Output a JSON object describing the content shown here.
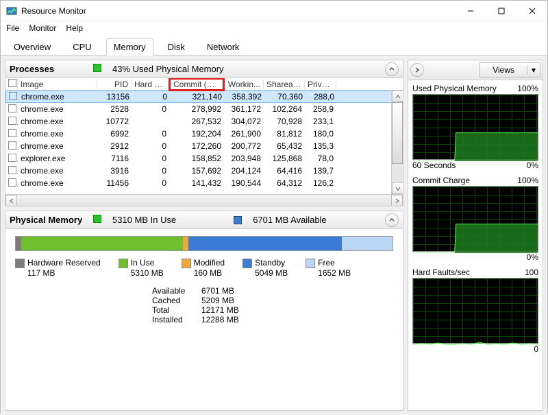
{
  "window": {
    "title": "Resource Monitor"
  },
  "menu": {
    "file": "File",
    "monitor": "Monitor",
    "help": "Help"
  },
  "tabs": {
    "overview": "Overview",
    "cpu": "CPU",
    "memory": "Memory",
    "disk": "Disk",
    "network": "Network"
  },
  "processes": {
    "title": "Processes",
    "summary": "43% Used Physical Memory",
    "columns": {
      "image": "Image",
      "pid": "PID",
      "hard": "Hard Fa...",
      "commit": "Commit (KB)",
      "working": "Workin...",
      "share": "Shareab...",
      "priv": "Privat..."
    },
    "rows": [
      {
        "image": "chrome.exe",
        "pid": "13156",
        "hf": "0",
        "commit": "321,140",
        "work": "358,392",
        "share": "70,360",
        "priv": "288,0"
      },
      {
        "image": "chrome.exe",
        "pid": "2528",
        "hf": "0",
        "commit": "278,992",
        "work": "361,172",
        "share": "102,264",
        "priv": "258,9"
      },
      {
        "image": "chrome.exe",
        "pid": "10772",
        "hf": "",
        "commit": "267,532",
        "work": "304,072",
        "share": "70,928",
        "priv": "233,1"
      },
      {
        "image": "chrome.exe",
        "pid": "6992",
        "hf": "0",
        "commit": "192,204",
        "work": "261,900",
        "share": "81,812",
        "priv": "180,0"
      },
      {
        "image": "chrome.exe",
        "pid": "2912",
        "hf": "0",
        "commit": "172,260",
        "work": "200,772",
        "share": "65,432",
        "priv": "135,3"
      },
      {
        "image": "explorer.exe",
        "pid": "7116",
        "hf": "0",
        "commit": "158,852",
        "work": "203,948",
        "share": "125,868",
        "priv": "78,0"
      },
      {
        "image": "chrome.exe",
        "pid": "3916",
        "hf": "0",
        "commit": "157,692",
        "work": "204,124",
        "share": "64,416",
        "priv": "139,7"
      },
      {
        "image": "chrome.exe",
        "pid": "11456",
        "hf": "0",
        "commit": "141,432",
        "work": "190,544",
        "share": "64,312",
        "priv": "126,2"
      }
    ]
  },
  "physical": {
    "title": "Physical Memory",
    "inuse": "5310 MB In Use",
    "avail": "6701 MB Available",
    "legend": {
      "reserved": {
        "name": "Hardware Reserved",
        "val": "117 MB"
      },
      "inuse": {
        "name": "In Use",
        "val": "5310 MB"
      },
      "modified": {
        "name": "Modified",
        "val": "160 MB"
      },
      "standby": {
        "name": "Standby",
        "val": "5049 MB"
      },
      "free": {
        "name": "Free",
        "val": "1652 MB"
      }
    },
    "stats": {
      "available": {
        "k": "Available",
        "v": "6701 MB"
      },
      "cached": {
        "k": "Cached",
        "v": "5209 MB"
      },
      "total": {
        "k": "Total",
        "v": "12171 MB"
      },
      "installed": {
        "k": "Installed",
        "v": "12288 MB"
      }
    }
  },
  "right": {
    "views": "Views",
    "charts": {
      "usedmem": {
        "title": "Used Physical Memory",
        "max": "100%",
        "min": "0%",
        "footer": "60 Seconds"
      },
      "commit": {
        "title": "Commit Charge",
        "max": "100%",
        "min": "0%"
      },
      "faults": {
        "title": "Hard Faults/sec",
        "max": "100",
        "min": "0"
      }
    }
  },
  "chart_data": [
    {
      "type": "area",
      "title": "Used Physical Memory",
      "ylim": [
        0,
        100
      ],
      "ylabel": "%",
      "x": "60 Seconds",
      "values": [
        0,
        0,
        0,
        0,
        0,
        0,
        0,
        0,
        0,
        0,
        43,
        43,
        43,
        43,
        43,
        43,
        43,
        43,
        43,
        43,
        43,
        43,
        43,
        43,
        43,
        43,
        43,
        43,
        43,
        43
      ]
    },
    {
      "type": "area",
      "title": "Commit Charge",
      "ylim": [
        0,
        100
      ],
      "ylabel": "%",
      "x": "60 Seconds",
      "values": [
        0,
        0,
        0,
        0,
        0,
        0,
        0,
        0,
        0,
        0,
        44,
        44,
        44,
        44,
        44,
        44,
        44,
        44,
        44,
        44,
        44,
        44,
        44,
        44,
        44,
        44,
        44,
        44,
        44,
        44
      ]
    },
    {
      "type": "line",
      "title": "Hard Faults/sec",
      "ylim": [
        0,
        100
      ],
      "ylabel": "",
      "x": "60 Seconds",
      "values": [
        0,
        1,
        0,
        2,
        0,
        0,
        1,
        0,
        3,
        0,
        1,
        0,
        0,
        2,
        0,
        1,
        0,
        0,
        1,
        0,
        2,
        0,
        0,
        1,
        0,
        0,
        1,
        0,
        2,
        0
      ]
    }
  ]
}
